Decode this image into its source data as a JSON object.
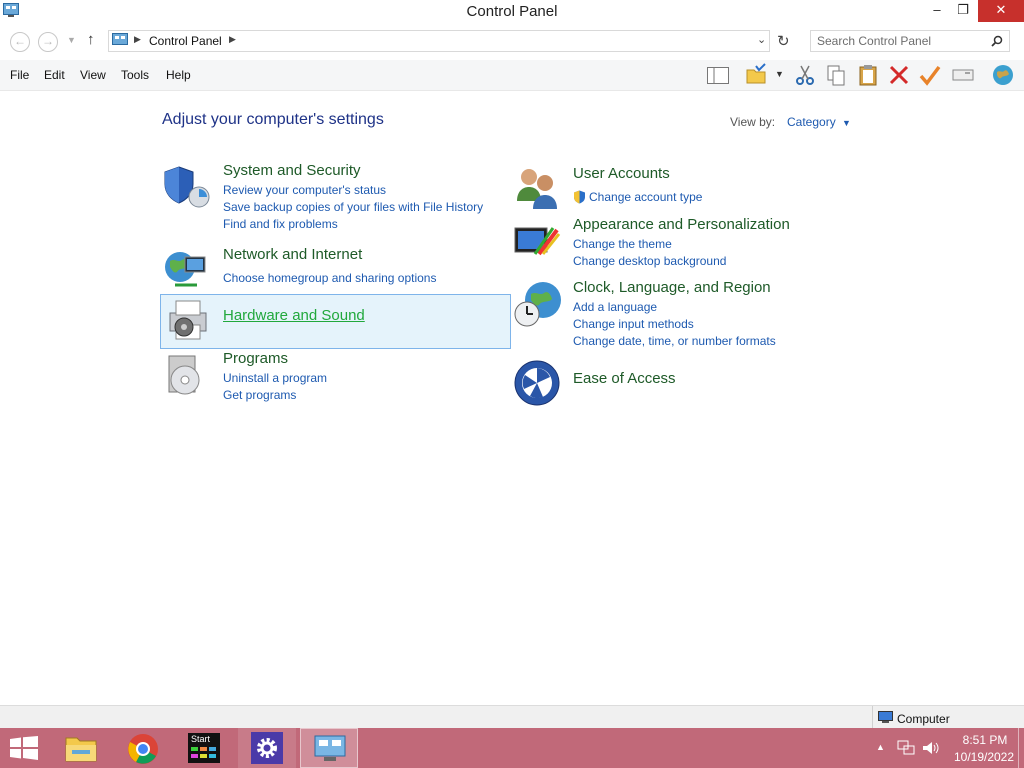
{
  "window": {
    "title": "Control Panel",
    "minimize": "–",
    "restore": "❐",
    "close": "✕"
  },
  "address": {
    "crumb": "Control Panel",
    "search_placeholder": "Search Control Panel"
  },
  "menu": [
    "File",
    "Edit",
    "View",
    "Tools",
    "Help"
  ],
  "content": {
    "heading": "Adjust your computer's settings",
    "view_by_label": "View by:",
    "view_by_value": "Category"
  },
  "categories": {
    "system": {
      "title": "System and Security",
      "links": [
        "Review your computer's status",
        "Save backup copies of your files with File History",
        "Find and fix problems"
      ]
    },
    "network": {
      "title": "Network and Internet",
      "links": [
        "Choose homegroup and sharing options"
      ]
    },
    "hardware": {
      "title": "Hardware and Sound"
    },
    "programs": {
      "title": "Programs",
      "links": [
        "Uninstall a program",
        "Get programs"
      ]
    },
    "users": {
      "title": "User Accounts",
      "links": [
        "Change account type"
      ]
    },
    "appearance": {
      "title": "Appearance and Personalization",
      "links": [
        "Change the theme",
        "Change desktop background"
      ]
    },
    "clock": {
      "title": "Clock, Language, and Region",
      "links": [
        "Add a language",
        "Change input methods",
        "Change date, time, or number formats"
      ]
    },
    "ease": {
      "title": "Ease of Access"
    }
  },
  "status": {
    "text": "Computer"
  },
  "taskbar": {
    "start_tile_label": "Start",
    "time": "8:51 PM",
    "date": "10/19/2022"
  },
  "colors": {
    "taskbar": "#c16979",
    "title_green": "#1e5a28",
    "link_blue": "#1e5ab0",
    "close_red": "#c7302c"
  }
}
